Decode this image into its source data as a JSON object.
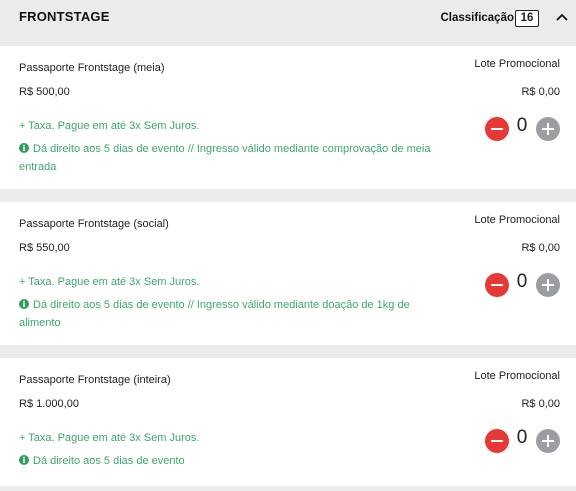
{
  "section": {
    "title": "FRONTSTAGE",
    "classification_label": "Classificação",
    "classification_count": "16"
  },
  "tickets": [
    {
      "name": "Passaporte Frontstage (meia)",
      "price": "R$ 500,00",
      "batch": "Lote Promocional",
      "fee": "R$ 0,00",
      "tax_note": "+ Taxa. Pague em até 3x Sem Juros.",
      "description": "Dá direito aos 5 dias de evento // Ingresso válido mediante comprovação de meia entrada",
      "quantity": "0"
    },
    {
      "name": "Passaporte Frontstage (social)",
      "price": "R$ 550,00",
      "batch": "Lote Promocional",
      "fee": "R$ 0,00",
      "tax_note": "+ Taxa. Pague em até 3x Sem Juros.",
      "description": "Dá direito aos 5 dias de evento // Ingresso válido mediante doação de 1kg de alimento",
      "quantity": "0"
    },
    {
      "name": "Passaporte Frontstage (inteira)",
      "price": "R$ 1.000,00",
      "batch": "Lote Promocional",
      "fee": "R$ 0,00",
      "tax_note": "+ Taxa. Pague em até 3x Sem Juros.",
      "description": "Dá direito aos 5 dias de evento",
      "quantity": "0"
    }
  ],
  "icons": {
    "info": "info-icon",
    "decrement": "minus-circle-icon",
    "increment": "plus-circle-icon",
    "collapse": "chevron-up-icon"
  },
  "colors": {
    "accent_green": "#3fa66e",
    "decrement_red": "#e53935",
    "increment_gray": "#9a9ea3"
  }
}
